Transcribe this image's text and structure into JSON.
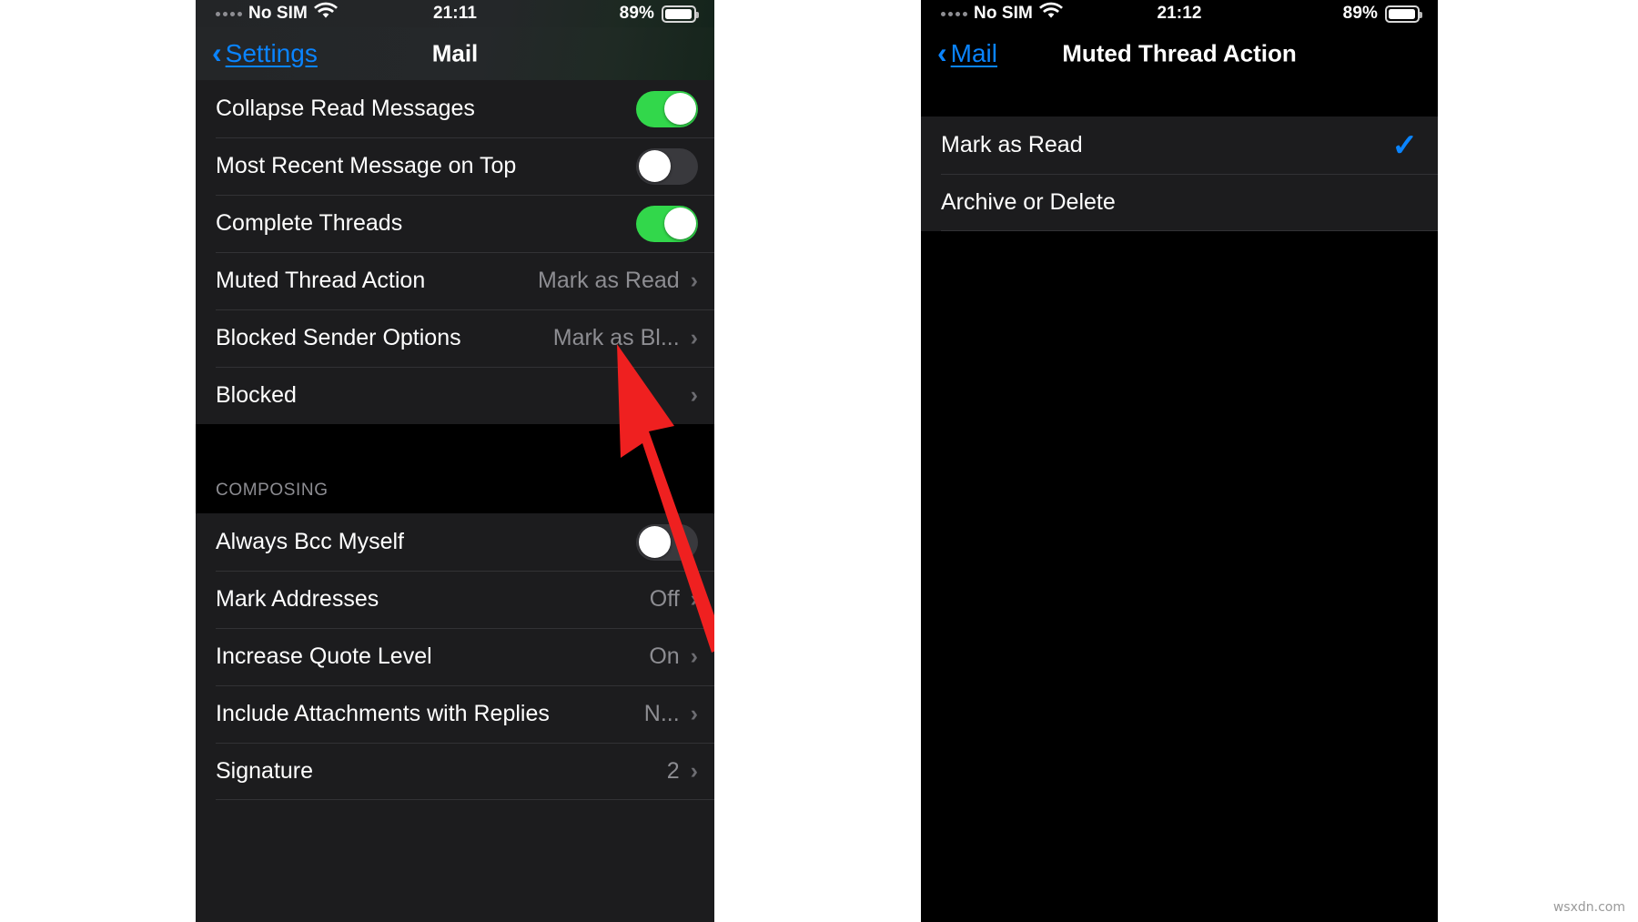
{
  "theme": {
    "accent_blue": "#0a84ff",
    "toggle_on_green": "#32d74b",
    "row_bg": "#1c1c1e",
    "page_bg": "#000000",
    "arrow_red": "#ef2020",
    "value_gray": "#8d8d92"
  },
  "watermark": "wsxdn.com",
  "left_phone": {
    "status_bar": {
      "carrier": "No SIM",
      "wifi_icon": "wifi-icon",
      "time": "21:11",
      "battery_percent": "89%",
      "battery_icon": "battery-icon"
    },
    "nav": {
      "back_icon": "chevron-left-icon",
      "back_label": "Settings",
      "title": "Mail"
    },
    "groups": [
      {
        "header": "",
        "rows": [
          {
            "label": "Collapse Read Messages",
            "control": "toggle",
            "value": "on",
            "name": "row-collapse-read-messages"
          },
          {
            "label": "Most Recent Message on Top",
            "control": "toggle",
            "value": "off",
            "name": "row-most-recent-message-on-top"
          },
          {
            "label": "Complete Threads",
            "control": "toggle",
            "value": "on",
            "name": "row-complete-threads"
          },
          {
            "label": "Muted Thread Action",
            "control": "disclosure",
            "value": "Mark as Read",
            "name": "row-muted-thread-action"
          },
          {
            "label": "Blocked Sender Options",
            "control": "disclosure",
            "value": "Mark as Bl...",
            "name": "row-blocked-sender-options"
          },
          {
            "label": "Blocked",
            "control": "disclosure",
            "value": "",
            "name": "row-blocked"
          }
        ]
      },
      {
        "header": "COMPOSING",
        "rows": [
          {
            "label": "Always Bcc Myself",
            "control": "toggle",
            "value": "off",
            "name": "row-always-bcc-myself"
          },
          {
            "label": "Mark Addresses",
            "control": "disclosure",
            "value": "Off",
            "name": "row-mark-addresses"
          },
          {
            "label": "Increase Quote Level",
            "control": "disclosure",
            "value": "On",
            "name": "row-increase-quote-level"
          },
          {
            "label": "Include Attachments with Replies",
            "control": "disclosure",
            "value": "N...",
            "name": "row-include-attachments-with-replies"
          },
          {
            "label": "Signature",
            "control": "disclosure",
            "value": "2",
            "name": "row-signature"
          }
        ]
      }
    ]
  },
  "right_phone": {
    "status_bar": {
      "carrier": "No SIM",
      "wifi_icon": "wifi-icon",
      "time": "21:12",
      "battery_percent": "89%",
      "battery_icon": "battery-icon"
    },
    "nav": {
      "back_icon": "chevron-left-icon",
      "back_label": "Mail",
      "title": "Muted Thread Action"
    },
    "options": [
      {
        "label": "Mark as Read",
        "selected": true,
        "name": "option-mark-as-read"
      },
      {
        "label": "Archive or Delete",
        "selected": false,
        "name": "option-archive-or-delete"
      }
    ]
  },
  "annotations": [
    {
      "name": "arrow-pointing-to-muted-thread-action",
      "color": "#ef2020"
    },
    {
      "name": "arrow-pointing-to-mark-as-read",
      "color": "#ef2020"
    }
  ]
}
